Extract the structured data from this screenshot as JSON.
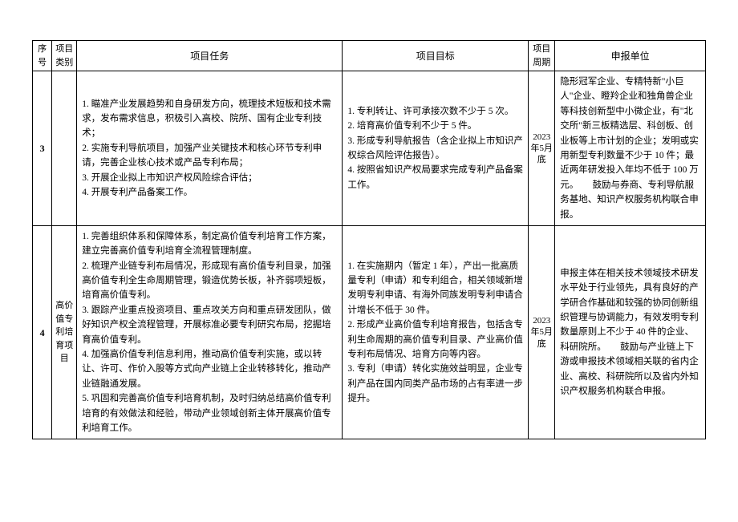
{
  "headers": {
    "seq": "序号",
    "category": "项目类别",
    "task": "项目任务",
    "goal": "项目目标",
    "period": "项目周期",
    "unit": "申报单位"
  },
  "rows": [
    {
      "seq": "3",
      "category": "",
      "task": "1. 瞄准产业发展趋势和自身研发方向，梳理技术短板和技术需求，发布需求信息，积极引入高校、院所、国有企业专利技术；\n2. 实施专利导航项目，加强产业关键技术和核心环节专利申请，完善企业核心技术或产品专利布局；\n3. 开展企业拟上市知识产权风险综合评估；\n4. 开展专利产品备案工作。",
      "goal": "1. 专利转让、许可承接次数不少于 5 次。\n2. 培育高价值专利不少于 5 件。\n3. 形成专利导航报告（含企业拟上市知识产权综合风险评估报告）。\n4. 按照省知识产权局要求完成专利产品备案工作。",
      "period": "2023年5月底",
      "unit": "隐形冠军企业、专精特新\"小巨人\"企业、瞪羚企业和独角兽企业等科技创新型中小微企业，有\"北交所\"新三板精选层、科创板、创业板等上市计划的企业；发明或实用新型专利数量不少于 10 件；最近两年研发投入年均不低于 100 万元。　　鼓励与券商、专利导航服务基地、知识产权服务机构联合申报。"
    },
    {
      "seq": "4",
      "category": "高价值专利培育项目",
      "task": "1. 完善组织体系和保障体系，制定高价值专利培育工作方案，建立完善高价值专利培育全流程管理制度。\n2. 梳理产业链专利布局情况，形成现有高价值专利目录，加强高价值专利全生命周期管理，锻造优势长板，补齐弱项短板，培育高价值专利。\n3. 跟踪产业重点投资项目、重点攻关方向和重点研发团队，做好知识产权全流程管理，开展标准必要专利研究布局，挖掘培育高价值专利。\n4. 加强高价值专利信息利用，推动高价值专利实施，或以转让、许可、作价入股等方式向产业链上企业转移转化，推动产业链融通发展。\n5. 巩固和完善高价值专利培育机制，及时归纳总结高价值专利培育的有效做法和经验，带动产业领域创新主体开展高价值专利培育工作。",
      "goal": "1. 在实施期内（暂定 1 年），产出一批高质量专利（申请）和专利组合，相关领域新增发明专利申请、有海外同族发明专利申请合计增长不低于 30 件。\n2. 形成产业高价值专利培育报告，包括含专利生命周期的高价值专利目录、产业高价值专利布局情况、培育方向等内容。\n3. 专利（申请）转化实施效益明显，企业专利产品在国内同类产品市场的占有率进一步提升。",
      "period": "2023年5月底",
      "unit": "申报主体在相关技术领域技术研发水平处于行业领先，具有良好的产学研合作基础和较强的协同创新组织管理与协调能力，有效发明专利数量原则上不少于 40 件的企业、科研院所。　　鼓励与产业链上下游或申报技术领域相关联的省内企业、高校、科研院所以及省内外知识产权服务机构联合申报。"
    }
  ]
}
